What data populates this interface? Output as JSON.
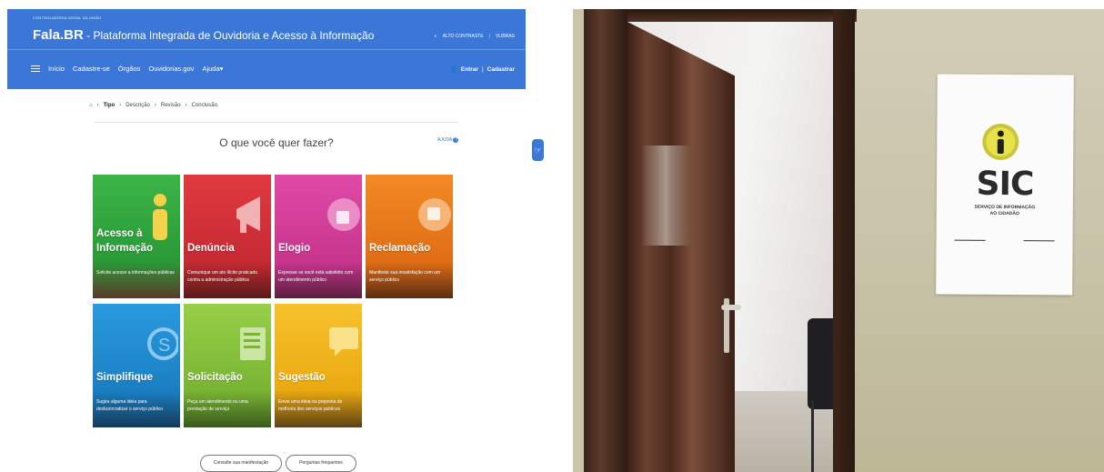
{
  "left": {
    "header": {
      "gov_small": "CONTROLADORIA-GERAL DA UNIÃO",
      "brand": "Fala.BR",
      "brand_rest": " - Plataforma Integrada de Ouvidoria e Acesso à Informação",
      "alto_contraste": "ALTO CONTRASTE",
      "vlibras": "VLIBRAS",
      "sep": "|"
    },
    "nav": {
      "items": [
        "Início",
        "Cadastre-se",
        "Órgãos",
        "Ouvidorias.gov",
        "Ajuda▾"
      ],
      "entrar": "Entrar",
      "cadastrar": "Cadastrar",
      "sep": "|"
    },
    "breadcrumb": {
      "items": [
        "Tipo",
        "Descrição",
        "Revisão",
        "Conclusão."
      ],
      "sep": "›"
    },
    "question": "O que você quer fazer?",
    "ajuda": "AJUDA",
    "tiles": [
      {
        "title": "Acesso à",
        "title2": "Informação",
        "desc": "Solicite acesso a informações públicas",
        "color": "#2fa83c"
      },
      {
        "title": "Denúncia",
        "title2": "",
        "desc": "Comunique um ato ilícito praticado contra a administração pública",
        "color": "#d32f37"
      },
      {
        "title": "Elogio",
        "title2": "",
        "desc": "Expresse se você está satisfeito com um atendimento público",
        "color": "#d4409a"
      },
      {
        "title": "Reclamação",
        "title2": "",
        "desc": "Manifeste sua insatisfação com um serviço público",
        "color": "#ef7b1c"
      },
      {
        "title": "Simplifique",
        "title2": "",
        "desc": "Sugira alguma ideia para desburocratizar o serviço público",
        "color": "#1e8fd4"
      },
      {
        "title": "Solicitação",
        "title2": "",
        "desc": "Peça um atendimento ou uma prestação de serviço",
        "color": "#8bc63e"
      },
      {
        "title": "Sugestão",
        "title2": "",
        "desc": "Envie uma ideia ou proposta de melhoria dos serviços públicos",
        "color": "#f3b71d"
      }
    ],
    "buttons": {
      "consulte": "Consulte sua manifestação",
      "perguntas": "Perguntas frequentes"
    }
  },
  "right": {
    "poster": {
      "title": "SIC",
      "sub1": "SERVIÇO DE INFORMAÇÃO",
      "sub2": "AO CIDADÃO"
    }
  }
}
